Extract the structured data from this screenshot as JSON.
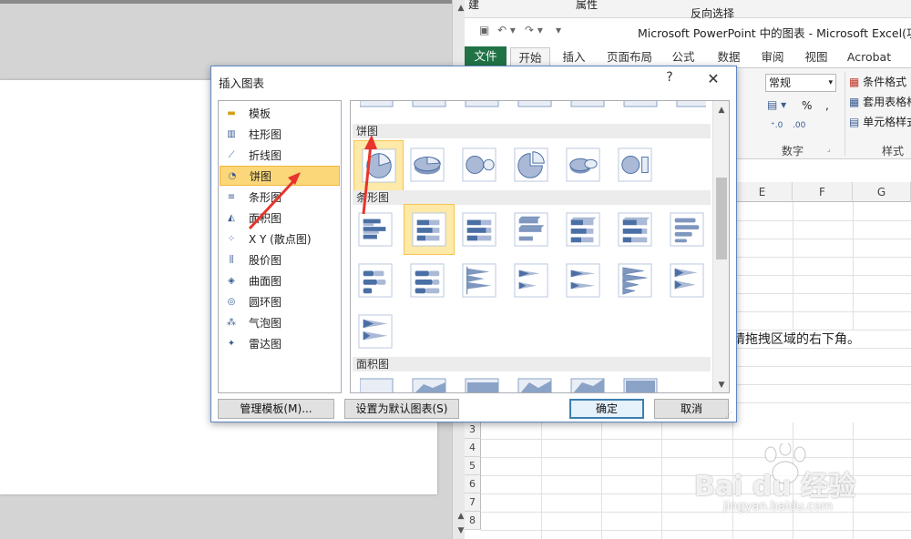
{
  "powerpoint": {},
  "excel": {
    "strip_items": [
      "建",
      "属性",
      "反向选择"
    ],
    "title": "Microsoft PowerPoint 中的图表 - Microsoft Excel(功",
    "tabs": [
      "文件",
      "开始",
      "插入",
      "页面布局",
      "公式",
      "数据",
      "审阅",
      "视图",
      "Acrobat"
    ],
    "ribbon": {
      "number_format": "常规",
      "percent": "%",
      "comma": ",",
      "group_number": "数字",
      "cond_format": "条件格式",
      "table_format": "套用表格格",
      "cell_style": "单元格样式",
      "group_styles": "样式"
    },
    "columns": [
      "E",
      "F",
      "G"
    ],
    "rows": [
      "3",
      "4",
      "5",
      "6",
      "7",
      "8"
    ],
    "cell_text": "请拖拽区域的右下角。"
  },
  "dialog": {
    "title": "插入图表",
    "help": "?",
    "close": "✕",
    "categories": [
      {
        "label": "模板",
        "icon": "folder-icon"
      },
      {
        "label": "柱形图",
        "icon": "column-chart-icon"
      },
      {
        "label": "折线图",
        "icon": "line-chart-icon"
      },
      {
        "label": "饼图",
        "icon": "pie-chart-icon",
        "selected": true
      },
      {
        "label": "条形图",
        "icon": "bar-chart-icon"
      },
      {
        "label": "面积图",
        "icon": "area-chart-icon"
      },
      {
        "label": "X Y (散点图)",
        "icon": "scatter-chart-icon"
      },
      {
        "label": "股价图",
        "icon": "stock-chart-icon"
      },
      {
        "label": "曲面图",
        "icon": "surface-chart-icon"
      },
      {
        "label": "圆环图",
        "icon": "doughnut-chart-icon"
      },
      {
        "label": "气泡图",
        "icon": "bubble-chart-icon"
      },
      {
        "label": "雷达图",
        "icon": "radar-chart-icon"
      }
    ],
    "sections": {
      "pie": "饼图",
      "bar": "条形图",
      "area": "面积图"
    },
    "buttons": {
      "manage_templates": "管理模板(M)...",
      "set_default": "设置为默认图表(S)",
      "ok": "确定",
      "cancel": "取消"
    }
  },
  "watermark": {
    "brand": "Bai du 经验",
    "url": "jingyan.baidu.com"
  },
  "colors": {
    "accent": "#217346",
    "selection": "#fbd77a",
    "chart_blue": "#4a6fa5",
    "annotation": "#e8342c"
  }
}
